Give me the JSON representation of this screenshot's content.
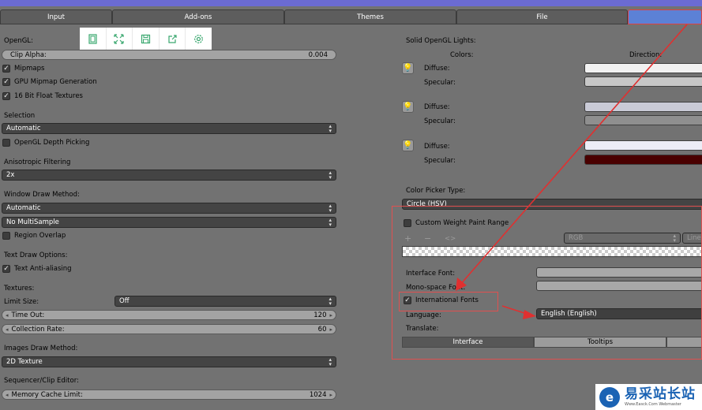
{
  "tabs": [
    "Input",
    "Add-ons",
    "Themes",
    "File",
    ""
  ],
  "toolbar_icons": [
    "fit-page-icon",
    "expand-icon",
    "save-icon",
    "export-icon",
    "settings-icon"
  ],
  "left": {
    "opengl_label": "OpenGL:",
    "clip_alpha": {
      "label": "Clip Alpha:",
      "value": "0.004"
    },
    "mipmaps": "Mipmaps",
    "gpu_mipmap": "GPU Mipmap Generation",
    "float_textures": "16 Bit Float Textures",
    "selection_label": "Selection",
    "selection_value": "Automatic",
    "depth_picking": "OpenGL Depth Picking",
    "aniso_label": "Anisotropic Filtering",
    "aniso_value": "2x",
    "window_draw_label": "Window Draw Method:",
    "window_draw_value": "Automatic",
    "multisample_value": "No MultiSample",
    "region_overlap": "Region Overlap",
    "text_draw_label": "Text Draw Options:",
    "text_aa": "Text Anti-aliasing",
    "textures_label": "Textures:",
    "limit_size_label": "Limit Size:",
    "limit_size_value": "Off",
    "time_out": {
      "label": "Time Out:",
      "value": "120"
    },
    "collection_rate": {
      "label": "Collection Rate:",
      "value": "60"
    },
    "images_draw_label": "Images Draw Method:",
    "images_draw_value": "2D Texture",
    "sequencer_label": "Sequencer/Clip Editor:",
    "memory_cache": {
      "label": "Memory Cache Limit:",
      "value": "1024"
    }
  },
  "right": {
    "solid_lights_label": "Solid OpenGL Lights:",
    "colors_label": "Colors:",
    "direction_label": "Direction:",
    "diffuse": "Diffuse:",
    "specular": "Specular:",
    "light_colors": [
      {
        "diffuse": "#f1f1f1",
        "specular": "#c7c7c7"
      },
      {
        "diffuse": "#c9cad6",
        "specular": "#8f8f8f"
      },
      {
        "diffuse": "#ececf6",
        "specular": "#4a0000"
      }
    ],
    "color_picker_label": "Color Picker Type:",
    "color_picker_value": "Circle (HSV)",
    "weight_paint": "Custom Weight Paint Range",
    "ramp_add": "+",
    "ramp_remove": "−",
    "ramp_flip": "<>",
    "ramp_mode": "RGB",
    "ramp_interp": "Linea",
    "interface_font": "Interface Font:",
    "mono_font": "Mono-space Font:",
    "intl_fonts": "International Fonts",
    "language_label": "Language:",
    "language_value": "English (English)",
    "translate_label": "Translate:",
    "translate_buttons": [
      "Interface",
      "Tooltips",
      ""
    ]
  },
  "watermark": {
    "logo": "e",
    "title": "易采站长站",
    "subtitle": "Www.Easck.Com   Webmaster"
  },
  "colors": {
    "accent_red": "#e04040",
    "active_tab": "#5c81d6",
    "toolbar_icon": "#3aa86f"
  }
}
